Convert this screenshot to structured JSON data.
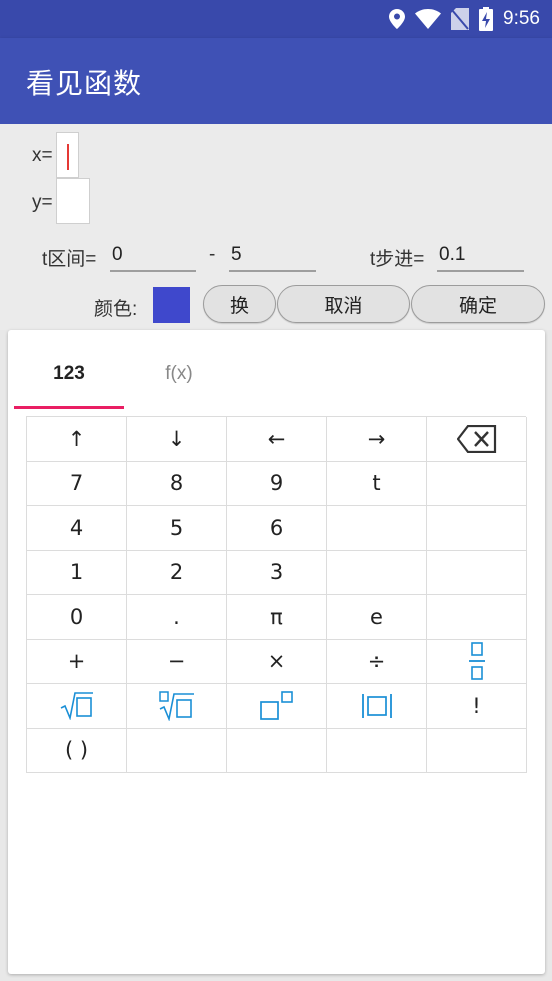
{
  "status": {
    "time": "9:56"
  },
  "app": {
    "title": "看见函数"
  },
  "form": {
    "x_label": "x=",
    "y_label": "y=",
    "t_range_label": "t区间=",
    "t_start": "0",
    "range_sep": "-",
    "t_end": "5",
    "t_step_label": "t步进=",
    "t_step": "0.1",
    "color_label": "颜色:",
    "color_value": "#3f48cc",
    "swap_label": "换",
    "cancel_label": "取消",
    "confirm_label": "确定"
  },
  "keyboard": {
    "tabs": [
      "123",
      "f(x)"
    ],
    "active_tab": "123",
    "keys": [
      {
        "name": "up-arrow-key",
        "label": "↑"
      },
      {
        "name": "down-arrow-key",
        "label": "↓"
      },
      {
        "name": "left-arrow-key",
        "label": "←"
      },
      {
        "name": "right-arrow-key",
        "label": "→"
      },
      {
        "name": "backspace-key",
        "label": "⌫",
        "icon": "backspace-icon"
      },
      {
        "name": "key-7",
        "label": "7"
      },
      {
        "name": "key-8",
        "label": "8"
      },
      {
        "name": "key-9",
        "label": "9"
      },
      {
        "name": "key-t",
        "label": "t"
      },
      {
        "name": "key-empty",
        "label": ""
      },
      {
        "name": "key-4",
        "label": "4"
      },
      {
        "name": "key-5",
        "label": "5"
      },
      {
        "name": "key-6",
        "label": "6"
      },
      {
        "name": "key-empty",
        "label": ""
      },
      {
        "name": "key-empty",
        "label": ""
      },
      {
        "name": "key-1",
        "label": "1"
      },
      {
        "name": "key-2",
        "label": "2"
      },
      {
        "name": "key-3",
        "label": "3"
      },
      {
        "name": "key-empty",
        "label": ""
      },
      {
        "name": "key-empty",
        "label": ""
      },
      {
        "name": "key-0",
        "label": "0"
      },
      {
        "name": "key-dot",
        "label": "."
      },
      {
        "name": "key-pi",
        "label": "π"
      },
      {
        "name": "key-e",
        "label": "e"
      },
      {
        "name": "key-empty",
        "label": ""
      },
      {
        "name": "plus-key",
        "label": "+"
      },
      {
        "name": "minus-key",
        "label": "−"
      },
      {
        "name": "multiply-key",
        "label": "×"
      },
      {
        "name": "divide-key",
        "label": "÷"
      },
      {
        "name": "fraction-key",
        "label": "",
        "icon": "fraction-icon"
      },
      {
        "name": "sqrt-key",
        "label": "",
        "icon": "sqrt-icon"
      },
      {
        "name": "nth-root-key",
        "label": "",
        "icon": "nth-root-icon"
      },
      {
        "name": "power-key",
        "label": "",
        "icon": "power-icon"
      },
      {
        "name": "abs-key",
        "label": "",
        "icon": "abs-icon"
      },
      {
        "name": "factorial-key",
        "label": "!"
      },
      {
        "name": "parentheses-key",
        "label": "( )"
      },
      {
        "name": "key-empty",
        "label": ""
      },
      {
        "name": "key-empty",
        "label": ""
      },
      {
        "name": "key-empty",
        "label": ""
      },
      {
        "name": "key-empty",
        "label": ""
      }
    ]
  }
}
